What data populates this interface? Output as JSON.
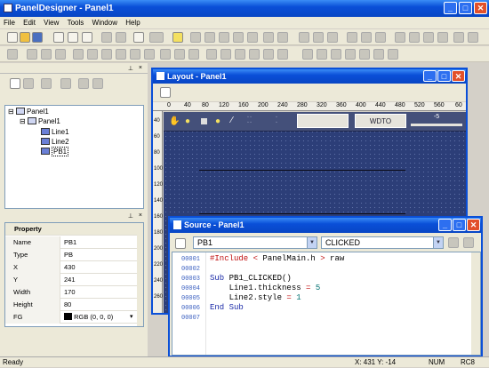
{
  "app": {
    "title": "PanelDesigner - Panel1",
    "min": "_",
    "max": "□",
    "close": "✕"
  },
  "menu": [
    "File",
    "Edit",
    "View",
    "Tools",
    "Window",
    "Help"
  ],
  "tree": {
    "root": "Panel1",
    "panel": "Panel1",
    "items": [
      "Line1",
      "Line2",
      "PB1"
    ]
  },
  "properties": {
    "header": "Property",
    "rows": [
      {
        "k": "Name",
        "v": "PB1"
      },
      {
        "k": "Type",
        "v": "PB"
      },
      {
        "k": "X",
        "v": "430"
      },
      {
        "k": "Y",
        "v": "241"
      },
      {
        "k": "Width",
        "v": "170"
      },
      {
        "k": "Height",
        "v": "80"
      },
      {
        "k": "FG",
        "v": "RGB (0, 0, 0)"
      }
    ]
  },
  "layout": {
    "title": "Layout - Panel1",
    "ruler": [
      "0",
      "40",
      "80",
      "120",
      "160",
      "200",
      "240",
      "280",
      "320",
      "360",
      "400",
      "440",
      "480",
      "520",
      "560",
      "60"
    ],
    "vruler": [
      "40",
      "60",
      "80",
      "100",
      "120",
      "140",
      "160",
      "180",
      "200",
      "220",
      "240",
      "260",
      "280"
    ],
    "button": "WDTO",
    "label": "-5"
  },
  "source": {
    "title": "Source - Panel1",
    "object": "PB1",
    "event": "CLICKED",
    "lines": [
      "00001",
      "00002",
      "00003",
      "00004",
      "00005",
      "00006",
      "00007"
    ],
    "code": [
      {
        "a": "#Include",
        "b": " < ",
        "c": "PanelMain.h",
        "d": " > ",
        "e": "raw"
      },
      {
        "a": "",
        "b": "",
        "c": "",
        "d": "",
        "e": ""
      },
      {
        "a": "Sub ",
        "b": "PB1_CLICKED()",
        "c": "",
        "d": "",
        "e": ""
      },
      {
        "a": "    Line1.thickness ",
        "b": "= ",
        "c": "5",
        "d": "",
        "e": ""
      },
      {
        "a": "    Line2.style ",
        "b": "= ",
        "c": "1",
        "d": "",
        "e": ""
      },
      {
        "a": "End Sub",
        "b": "",
        "c": "",
        "d": "",
        "e": ""
      },
      {
        "a": "",
        "b": "",
        "c": "",
        "d": "",
        "e": ""
      }
    ]
  },
  "status": {
    "left": "Ready",
    "coords": "X:  431 Y:   -14",
    "num": "NUM",
    "rc": "RC8"
  }
}
